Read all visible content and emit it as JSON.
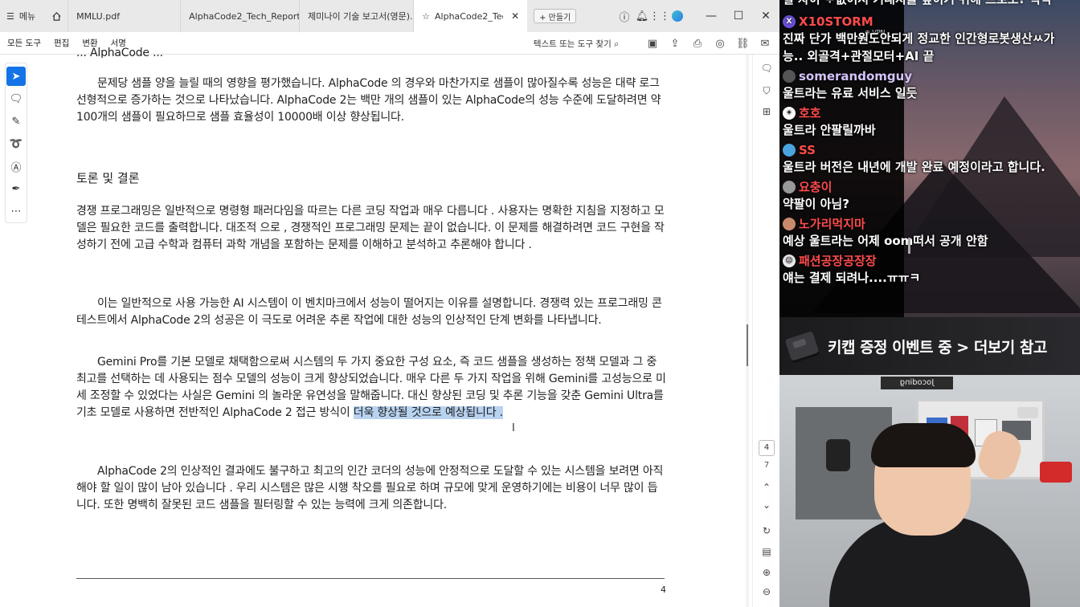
{
  "tabbar": {
    "menu_label": "메뉴",
    "tabs": [
      {
        "label": "MMLU.pdf"
      },
      {
        "label": "AlphaCode2_Tech_Report.pdf"
      },
      {
        "label": "제미나이 기술 보고서(영문)..."
      },
      {
        "label": "AlphaCode2_Tech_Re..."
      }
    ],
    "new_tab_label": "+ 만들기",
    "window_controls": [
      "minimize-icon",
      "maximize-icon",
      "close-icon"
    ]
  },
  "toolbar": {
    "items": [
      "모든 도구",
      "편집",
      "변환",
      "서명"
    ],
    "search_label": "텍스트 또는 도구 찾기"
  },
  "document": {
    "para_top_clip": "... AlphaCode ...",
    "para1": "문제당 샘플 양을 늘릴 때의 영향을 평가했습니다. AlphaCode 의 경우와 마찬가지로 샘플이 많아질수록 성능은 대략 로그 선형적으로 증가하는 것으로 나타났습니다. AlphaCode 2는 백만 개의 샘플이 있는 AlphaCode의 성능 수준에 도달하려면 약 100개의 샘플이 필요하므로 샘플 효율성이 10000배 이상 향상됩니다.",
    "heading": "토론 및 결론",
    "para2": "경쟁 프로그래밍은 일반적으로 명령형 패러다임을 따르는 다른 코딩 작업과 매우 다릅니다 . 사용자는 명확한 지침을 지정하고 모델은 필요한 코드를 출력합니다. 대조적 으로 , 경쟁적인 프로그래밍 문제는 끝이 없습니다. 이 문제를 해결하려면 코드 구현을 작성하기 전에 고급 수학과 컴퓨터 과학 개념을 포함하는 문제를 이해하고 분석하고 추론해야 합니다 .",
    "para3": "이는 일반적으로 사용 가능한 AI 시스템이 이 벤치마크에서 성능이 떨어지는 이유를 설명합니다. 경쟁력 있는 프로그래밍 콘테스트에서 AlphaCode 2의 성공은 이 극도로 어려운 추론 작업에 대한 성능의 인상적인 단계 변화를 나타냅니다.",
    "para4_main": "Gemini Pro를 기본 모델로 채택함으로써 시스템의 두 가지 중요한 구성 요소, 즉 코드 샘플을 생성하는 정책 모델과 그 중 최고를 선택하는 데 사용되는 점수 모델의 성능이 크게 향상되었습니다. 매우 다른 두 가지 작업을 위해 Gemini를 고성능으로 미세 조정할 수 있었다는 사실은 Gemini 의 놀라운 유연성을 말해줍니다. 대신 향상된 코딩 및 추론 기능을 갖춘 Gemini Ultra를 기초 모델로 사용하면 전반적인 AlphaCode 2 접근 방식이 ",
    "para4_highlight": "더욱 향상될 것으로 예상됩니다 .",
    "para5": "AlphaCode 2의 인상적인 결과에도 불구하고 최고의 인간 코더의 성능에 안정적으로 도달할 수 있는 시스템을 보려면 아직 해야 할 일이 많이 남아 있습니다 . 우리 시스템은 많은 시행 착오를 필요로 하며 규모에 맞게 운영하기에는 비용이 너무 많이 듭니다. 또한 명백히 잘못된 코드 샘플을 필터링할 수 있는 능력에 크게 의존합니다.",
    "page_number": "4"
  },
  "side_panel": {
    "current_page": "4",
    "total_pages": "7"
  },
  "chat": {
    "top_clip": "일 자이 ᄇᆞ없어서 기대지를 높이기 위해 프로도? 박막",
    "vpn_label": "⊕ VPN",
    "messages": [
      {
        "name": "X10STORM",
        "name_color": "#ff4b4b",
        "text": "진짜 단가 백만원도안되게 정교한 인간형로봇생산ㅆ가",
        "text2": "능.. 외골격+관절모터+AI 끝"
      },
      {
        "name": "somerandomguy",
        "name_color": "#d6c4ff",
        "text": "울트라는 유료 서비스 일듯"
      },
      {
        "name": "호호",
        "name_color": "#ff4b4b",
        "text": "울트라 안팔릴까바"
      },
      {
        "name": "SS",
        "name_color": "#ff4b4b",
        "text": "울트라 버전은 내년에 개발 완료 예정이라고 합니다."
      },
      {
        "name": "요충이",
        "name_color": "#ff4b4b",
        "text": "약팔이 아님?"
      },
      {
        "name": "노가리먹지마",
        "name_color": "#ff4b4b",
        "text": "예상 울트라는 어제 oom떠서 공개 안함"
      },
      {
        "name": "패션공장공장장",
        "name_color": "#ff4b4b",
        "text": "얘는 결제 되려나....ㅠㅠㅋ"
      }
    ]
  },
  "banner": {
    "text": "키캡 증정 이벤트 중 > 더보기 참고"
  },
  "webcam": {
    "sign_text": "Jocoding"
  }
}
